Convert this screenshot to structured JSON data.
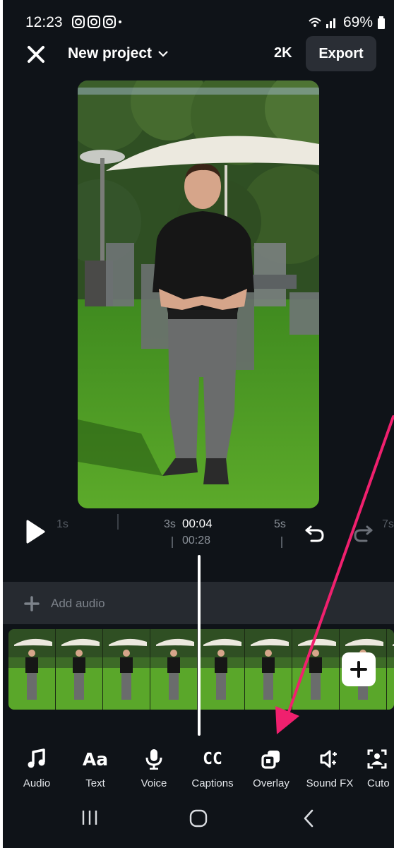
{
  "status_bar": {
    "time": "12:23",
    "battery": "69%"
  },
  "top_bar": {
    "project_title": "New project",
    "quality": "2K",
    "export_label": "Export"
  },
  "timeline": {
    "current_time": "00:04",
    "total_time": "00:28",
    "ticks": [
      "1s",
      "3s",
      "5s",
      "7s"
    ]
  },
  "audio_track": {
    "add_label": "Add audio"
  },
  "toolbar": {
    "items": [
      {
        "label": "Audio",
        "icon": "music-note-icon"
      },
      {
        "label": "Text",
        "icon": "text-aa-icon"
      },
      {
        "label": "Voice",
        "icon": "microphone-icon"
      },
      {
        "label": "Captions",
        "icon": "cc-icon"
      },
      {
        "label": "Overlay",
        "icon": "overlay-icon"
      },
      {
        "label": "Sound FX",
        "icon": "sound-fx-icon"
      },
      {
        "label": "Cuto",
        "icon": "cutout-icon"
      }
    ]
  },
  "colors": {
    "background": "#0f1318",
    "accent_arrow": "#f0206e",
    "export_bg": "#2a2e35"
  }
}
